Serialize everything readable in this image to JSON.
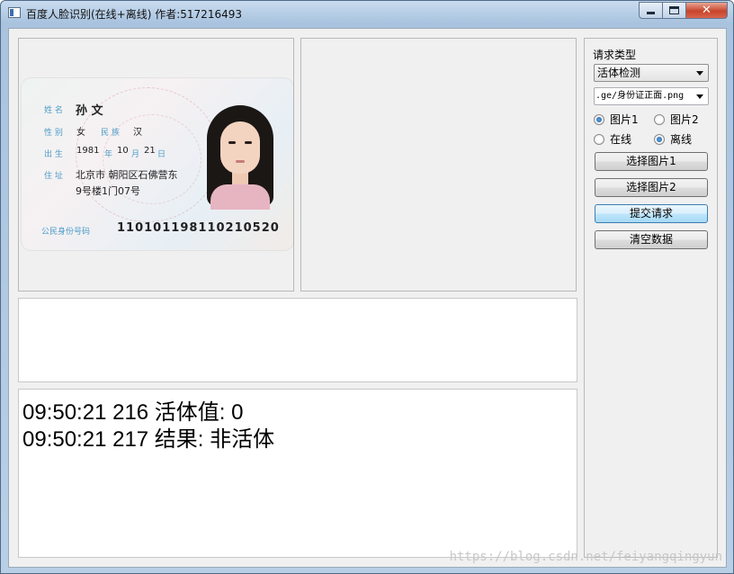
{
  "window": {
    "title": "百度人脸识别(在线+离线) 作者:517216493",
    "min_icon": "minimize-icon",
    "max_icon": "maximize-icon",
    "close_symbol": "✕"
  },
  "idcard": {
    "name_label": "姓 名",
    "name": "孙 文",
    "gender_label": "性 别",
    "gender": "女",
    "ethnicity_label": "民 族",
    "ethnicity": "汉",
    "birth_label": "出 生",
    "birth_year": "1981",
    "year_label": "年",
    "birth_month": "10",
    "month_label": "月",
    "birth_day": "21",
    "day_label": "日",
    "address_label": "住 址",
    "address_line1": "北京市 朝阳区石佛营东",
    "address_line2": "9号楼1门07号",
    "id_label": "公民身份号码",
    "id_number": "110101198110210520"
  },
  "controls": {
    "request_type_label": "请求类型",
    "request_type_value": "活体检测",
    "file_path": ".ge/身份证正面.png",
    "radio_image1": "图片1",
    "radio_image2": "图片2",
    "radio_online": "在线",
    "radio_offline": "离线",
    "btn_select1": "选择图片1",
    "btn_select2": "选择图片2",
    "btn_submit": "提交请求",
    "btn_clear": "清空数据"
  },
  "log": {
    "lines": [
      "09:50:21 216  活体值: 0",
      "09:50:21 217  结果: 非活体"
    ]
  },
  "watermark": "https://blog.csdn.net/feiyangqingyun"
}
